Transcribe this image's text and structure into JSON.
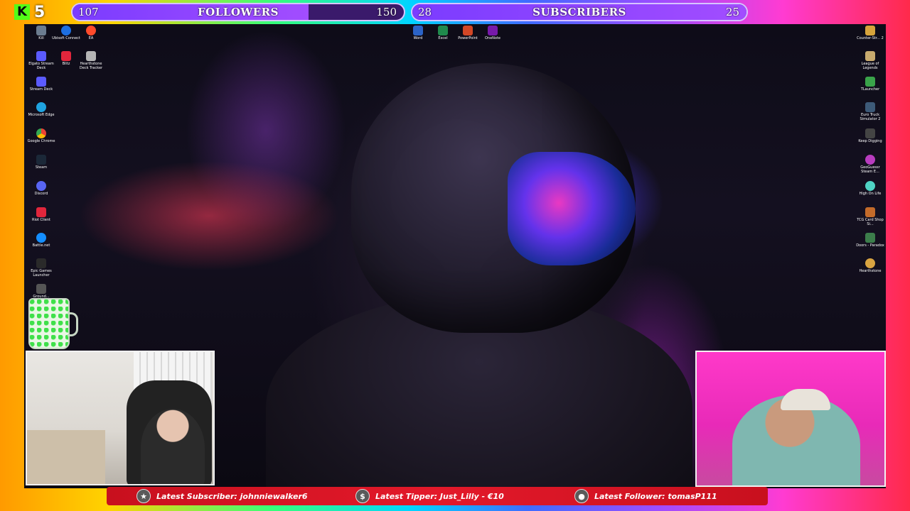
{
  "kick": {
    "logo_letter": "K",
    "viewer_count": "5"
  },
  "goals": {
    "followers": {
      "current": "107",
      "label": "FOLLOWERS",
      "target": "150",
      "progress": 0.713
    },
    "subscribers": {
      "current": "28",
      "label": "SUBSCRIBERS",
      "target": "25",
      "progress": 1.0
    }
  },
  "desktop_icons": {
    "left_col1": [
      "Kill",
      "Elgato Stream Deck",
      "Stream Deck",
      "Microsoft Edge",
      "Google Chrome",
      "Steam",
      "Discord",
      "Riot Client",
      "Battle.net",
      "Epic Games Launcher",
      "Ground..."
    ],
    "left_col2": [
      "Ubisoft Connect",
      "Blitz"
    ],
    "left_col3": [
      "EA",
      "Hearthstone Deck Tracker"
    ],
    "top_center": [
      "Word",
      "Excel",
      "PowerPoint",
      "OneNote"
    ],
    "right_col": [
      "Counter-Str... 2",
      "League of Legends",
      "TLauncher",
      "Euro Truck Simulator 2",
      "Keep Digging",
      "GeoGuessr Steam E...",
      "High On Life",
      "TCG Card Shop Si...",
      "Doors - Paradox",
      "Hearthstone"
    ]
  },
  "ticker": {
    "subscriber": "Latest Subscriber: johnniewalker6",
    "tipper": "Latest Tipper: Just_Lilly - €10",
    "follower": "Latest Follower: tomasP111"
  },
  "colors": {
    "kick_green": "#53fc18",
    "goal_fill": "#7b3cff",
    "ticker_red": "#e3192a"
  }
}
